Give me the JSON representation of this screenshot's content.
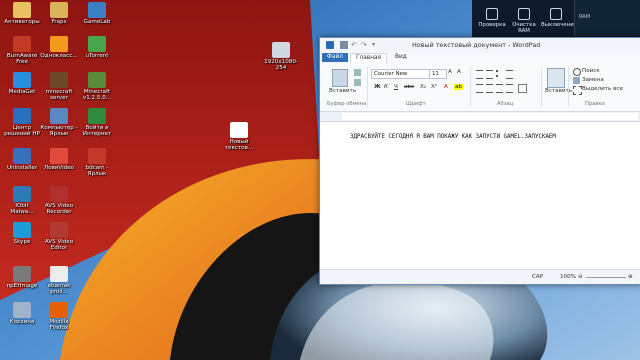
{
  "desktop": {
    "icons": [
      {
        "label": "Активаторы",
        "color": "#e8c160"
      },
      {
        "label": "Fraps",
        "color": "#d8b35a"
      },
      {
        "label": "GameLab",
        "color": "#3a7fc4"
      },
      {
        "label": "BurnAware Free",
        "color": "#c23b22"
      },
      {
        "label": "Однокласс...",
        "color": "#f39a1e"
      },
      {
        "label": "uTorrent",
        "color": "#4aa64a"
      },
      {
        "label": "MediaGet",
        "color": "#2a8de0"
      },
      {
        "label": "minecraft server",
        "color": "#6b4a2b"
      },
      {
        "label": "Minecraft v1.2.5.0...",
        "color": "#5a8a3a"
      },
      {
        "label": "Центр решений HP",
        "color": "#2a6fc0"
      },
      {
        "label": "Компьютер - Ярлык",
        "color": "#5a89c2"
      },
      {
        "label": "Войти в Интернет",
        "color": "#2d8a3e"
      },
      {
        "label": "Uninstaller",
        "color": "#3a6fbd"
      },
      {
        "label": "ЛовиVideo",
        "color": "#e04a3a"
      },
      {
        "label": "bdcam - Ярлык",
        "color": "#c0392b"
      },
      {
        "label": "IObit Malwa...",
        "color": "#2c7ab8"
      },
      {
        "label": "AVS Video Recorder",
        "color": "#b03030"
      },
      {
        "label": "Skype",
        "color": "#1b9bd7"
      },
      {
        "label": "AVS Video Editor",
        "color": "#b13a32"
      },
      {
        "label": "npEHmage",
        "color": "#7a7a7a"
      },
      {
        "label": "ebantak proii...",
        "color": "#ececec"
      },
      {
        "label": "Корзина",
        "color": "#9fb4c8"
      },
      {
        "label": "Mozilla Firefox",
        "color": "#e66000"
      },
      {
        "label": "1920x1080-254",
        "color": "#d0d8e0"
      },
      {
        "label": "Новый текстов...",
        "color": "#ffffff"
      }
    ]
  },
  "widgets": {
    "items": [
      {
        "label": "Проверка"
      },
      {
        "label": "Очистка RAM"
      },
      {
        "label": "Выключение"
      }
    ],
    "ram_label": "RAM"
  },
  "wordpad": {
    "title": "Новый текстовый документ - WordPad",
    "tabs": {
      "file": "Файл",
      "home": "Главная",
      "view": "Вид"
    },
    "ribbon": {
      "paste": "Вставить",
      "clipboard_group": "Буфер обмена",
      "font_name": "Courier New",
      "font_size": "11",
      "font_group": "Шрифт",
      "paragraph_group": "Абзац",
      "insert": "Вставить",
      "find": "Поиск",
      "replace": "Замена",
      "select_all": "Выделить все",
      "editing_group": "Правка"
    },
    "document_text": "ЗДРАСВУЙТЕ СЕГОДНЯ Я ВАМ ПОКАЖУ КАК ЗАПУСТИ GAMEL.ЗАПУСКАЕМ",
    "status": {
      "caps": "САР",
      "zoom": "100%"
    }
  },
  "colors": {
    "accent": "#2e6fb7",
    "wall_red": "#a8201c",
    "wall_orange": "#f0901a",
    "wall_blue": "#3a7ec7"
  }
}
